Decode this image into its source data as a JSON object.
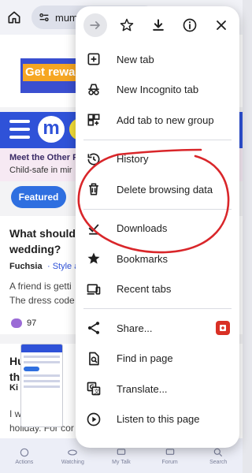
{
  "browser": {
    "url_text": "mums",
    "home_icon": "home-icon",
    "site_info_icon": "site-settings-icon"
  },
  "page": {
    "ad_text": "Get rewar",
    "promo_line1": "Meet the Other P",
    "promo_line2": "Child-safe in mir",
    "featured_label": "Featured",
    "card1": {
      "title_line1": "What should",
      "title_line2": "wedding?",
      "author": "Fuchsia",
      "category": "· Style a",
      "body_line1": "A friend is getti",
      "body_line2": "The dress code",
      "comments": "97"
    },
    "card2": {
      "title_line1": "Hu",
      "title_line2": "thre",
      "author": "Ki",
      "author_suffix": "IBU",
      "body_line1": "I w",
      "body_line1_tail": "to t",
      "body_line2": "holiday. For cor"
    }
  },
  "bottombar": {
    "items": [
      "Actions",
      "Watching",
      "My Talk",
      "Forum",
      "Search"
    ]
  },
  "menu": {
    "toolbar": {
      "forward_icon": "arrow-forward-icon",
      "bookmark_icon": "star-icon",
      "download_icon": "download-icon",
      "info_icon": "info-icon",
      "close_icon": "close-icon"
    },
    "items": [
      {
        "label": "New tab",
        "icon": "new-tab-icon"
      },
      {
        "label": "New Incognito tab",
        "icon": "incognito-icon"
      },
      {
        "label": "Add tab to new group",
        "icon": "tab-group-icon"
      },
      {
        "label": "History",
        "icon": "history-icon"
      },
      {
        "label": "Delete browsing data",
        "icon": "trash-icon"
      },
      {
        "label": "Downloads",
        "icon": "download-done-icon"
      },
      {
        "label": "Bookmarks",
        "icon": "star-filled-icon"
      },
      {
        "label": "Recent tabs",
        "icon": "devices-icon"
      },
      {
        "label": "Share...",
        "icon": "share-icon"
      },
      {
        "label": "Find in page",
        "icon": "find-in-page-icon"
      },
      {
        "label": "Translate...",
        "icon": "translate-icon"
      },
      {
        "label": "Listen to this page",
        "icon": "play-circle-icon"
      }
    ]
  },
  "colors": {
    "site_blue": "#2f52d8",
    "annotation_red": "#d9262a"
  }
}
